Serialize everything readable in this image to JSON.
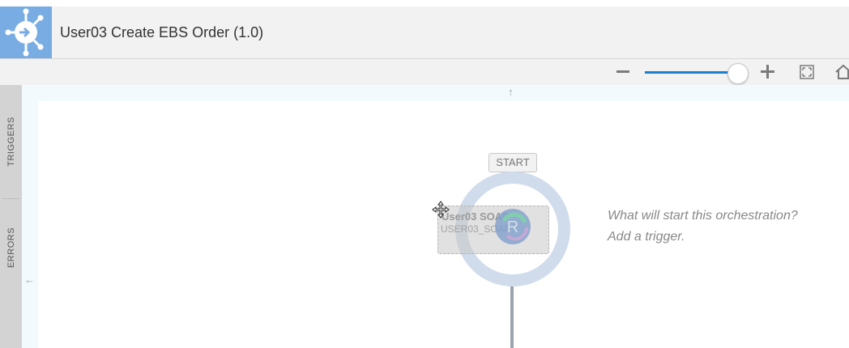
{
  "header": {
    "title": "User03 Create EBS Order (1.0)",
    "icon": "integration-orchestration-icon"
  },
  "toolbar": {
    "zoom_level": 0.92,
    "zoom_out_icon": "minus-icon",
    "zoom_in_icon": "plus-icon",
    "fit_icon": "fit-to-screen-icon",
    "home_icon": "home-icon",
    "accent_color": "#1a7fd1"
  },
  "left_rail": {
    "tabs": [
      {
        "label": "TRIGGERS"
      },
      {
        "label": "ERRORS"
      }
    ]
  },
  "canvas": {
    "start_label": "START",
    "dragging_item": {
      "name": "User03 SOAP",
      "id": "USER03_SOAP"
    },
    "prompt_line1": "What will start this orchestration?",
    "prompt_line2": "Add a trigger.",
    "up_arrow": "↑",
    "left_arrow": "←"
  }
}
